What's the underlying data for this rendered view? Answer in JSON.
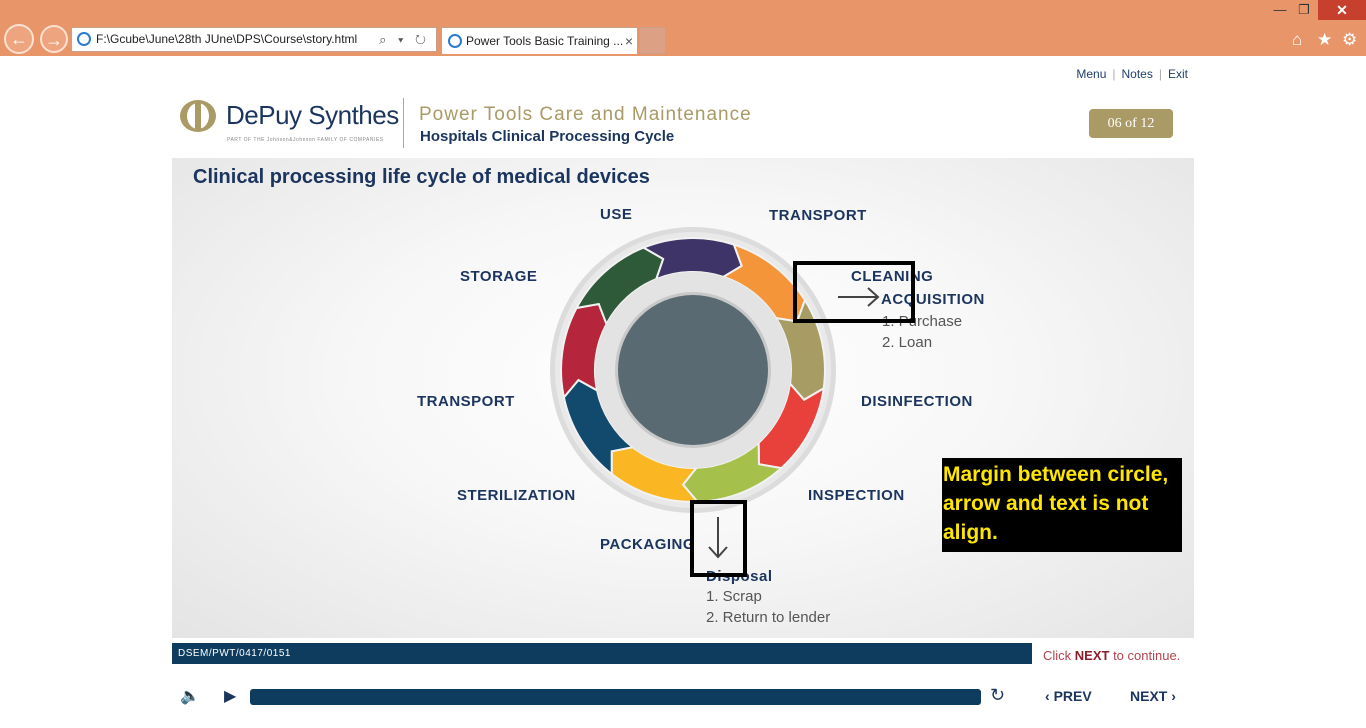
{
  "browser": {
    "address": "F:\\Gcube\\June\\28th JUne\\DPS\\Course\\story.html",
    "tab_title": "Power Tools Basic Training ...",
    "tab_close": "×",
    "address_tools": "⌕ ▾ ↻"
  },
  "toplinks": {
    "menu": "Menu",
    "notes": "Notes",
    "exit": "Exit",
    "sep": "|"
  },
  "brand": {
    "name": "DePuy Synthes",
    "tagline": "PART OF THE Johnson&Johnson FAMILY OF COMPANIES"
  },
  "course": {
    "title": "Power Tools Care and Maintenance",
    "subtitle": "Hospitals Clinical Processing Cycle"
  },
  "page_counter": "06 of 12",
  "slide": {
    "title": "Clinical processing life cycle of medical devices",
    "stages": {
      "use": "USE",
      "transport_top": "TRANSPORT",
      "storage": "STORAGE",
      "cleaning": "CLEANING",
      "transport_left": "TRANSPORT",
      "disinfection": "DISINFECTION",
      "sterilization": "STERILIZATION",
      "inspection": "INSPECTION",
      "packaging": "PACKAGING"
    },
    "acquisition": {
      "heading": "ACQUISITION",
      "items": [
        "1.  Purchase",
        "2.  Loan"
      ]
    },
    "disposal": {
      "heading": "Disposal",
      "items": [
        "1.  Scrap",
        "2.  Return to lender"
      ]
    },
    "cycle_colors": [
      "#f39538",
      "#a79d64",
      "#e8403a",
      "#a6c04c",
      "#fbb723",
      "#124a6e",
      "#b5253b",
      "#2f5a3a",
      "#3e3467"
    ],
    "hub_color": "#5a6a73"
  },
  "annotation": {
    "note": "Margin between circle, arrow and text is not align."
  },
  "footer": {
    "code": "DSEM/PWT/0417/0151",
    "continue_pre": "Click ",
    "continue_next": "NEXT",
    "continue_post": " to continue."
  },
  "player": {
    "prev": "PREV",
    "next": "NEXT"
  }
}
